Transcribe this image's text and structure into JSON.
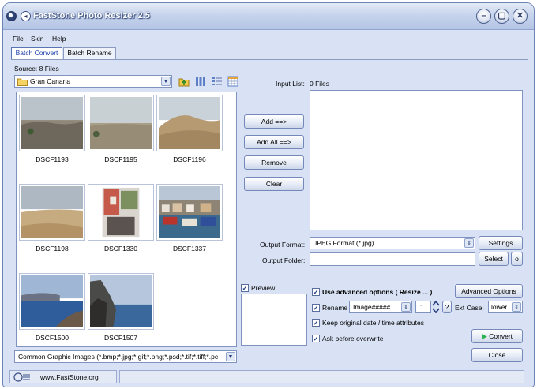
{
  "window": {
    "title": "FastStone Photo Resizer 2.5"
  },
  "menu": [
    "File",
    "Skin",
    "Help"
  ],
  "tabs": [
    "Batch Convert",
    "Batch Rename"
  ],
  "source": {
    "label": "Source: 8 Files",
    "folder": "Gran Canaria",
    "files": [
      "DSCF1193",
      "DSCF1195",
      "DSCF1196",
      "DSCF1198",
      "DSCF1330",
      "DSCF1337",
      "DSCF1500",
      "DSCF1507"
    ],
    "filter": "Common Graphic Images (*.bmp;*.jpg;*.gif;*.png;*.psd;*.tif;*.tiff;*.pc"
  },
  "buttons": {
    "add": "Add ==>",
    "add_all": "Add All ==>",
    "remove": "Remove",
    "clear": "Clear",
    "settings": "Settings",
    "select": "Select",
    "open_folder": "o",
    "advanced": "Advanced Options",
    "convert": "Convert",
    "close": "Close"
  },
  "input_list": {
    "label": "Input List:",
    "count": "0 Files"
  },
  "output": {
    "format_label": "Output Format:",
    "format_value": "JPEG Format (*.jpg)",
    "folder_label": "Output Folder:",
    "folder_value": ""
  },
  "preview": {
    "label": "Preview",
    "checked": true
  },
  "options": {
    "use_advanced": "Use advanced options ( Resize ... )",
    "rename": "Rename",
    "rename_pattern": "Image#####",
    "rename_start": "1",
    "help": "?",
    "ext_case_label": "Ext Case:",
    "ext_case_value": "lower",
    "keep_date": "Keep original date / time attributes",
    "ask_overwrite": "Ask before overwrite"
  },
  "status": {
    "url": "www.FastStone.org"
  },
  "colors": {
    "accent": "#1a3fa8",
    "frame": "#d8e2f4",
    "convert_arrow": "#2bb24c"
  }
}
